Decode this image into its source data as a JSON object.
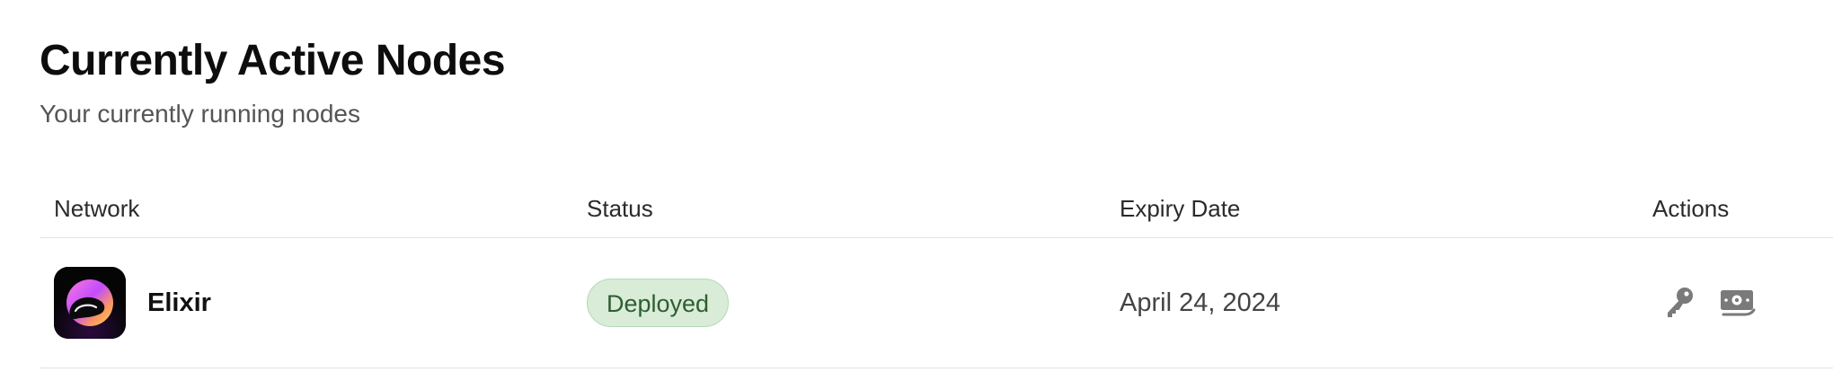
{
  "header": {
    "title": "Currently Active Nodes",
    "subtitle": "Your currently running nodes"
  },
  "table": {
    "columns": [
      "Network",
      "Status",
      "Expiry Date",
      "Actions"
    ],
    "rows": [
      {
        "network": "Elixir",
        "logo_icon": "elixir-logo-icon",
        "status": "Deployed",
        "expiry_date": "April 24, 2024",
        "actions": [
          "key-icon",
          "money-icon"
        ]
      }
    ]
  },
  "colors": {
    "status_badge_bg": "#d8ecd8",
    "status_badge_text": "#2f5d30",
    "action_icon": "#7a7a7a"
  }
}
